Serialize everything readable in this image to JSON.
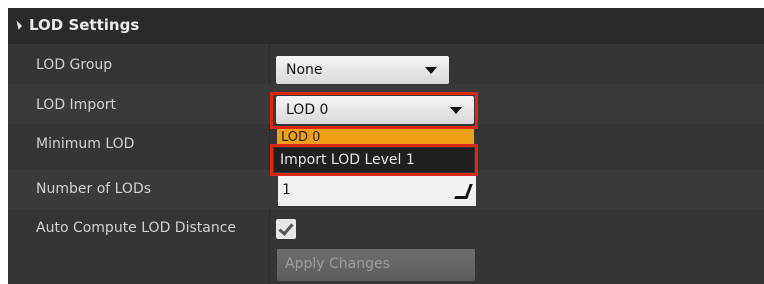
{
  "section": {
    "title": "LOD Settings"
  },
  "rows": [
    {
      "label": "LOD Group"
    },
    {
      "label": "LOD Import"
    },
    {
      "label": "Minimum LOD"
    },
    {
      "label": "Number of LODs"
    },
    {
      "label": "Auto Compute LOD Distance"
    }
  ],
  "lod_group": {
    "value": "None"
  },
  "lod_import": {
    "value": "LOD 0",
    "options": [
      "LOD 0",
      "Import LOD Level 1"
    ]
  },
  "number_of_lods": {
    "value": "1"
  },
  "auto_compute": {
    "checked": true
  },
  "apply_button": {
    "label": "Apply Changes"
  },
  "colors": {
    "highlight_red": "#e0260f",
    "dropdown_selected": "#f0a010",
    "panel_bg": "#353535"
  }
}
